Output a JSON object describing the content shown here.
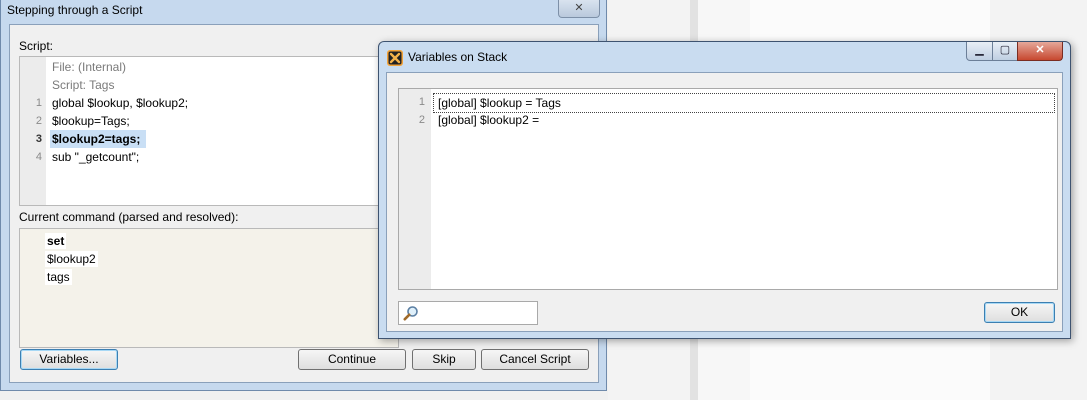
{
  "main_dialog": {
    "title": "Stepping through a Script",
    "close_glyph": "✕",
    "script_label": "Script:",
    "script_lines": [
      {
        "ln": "",
        "text": "File: (Internal)"
      },
      {
        "ln": "",
        "text": "Script: Tags"
      },
      {
        "ln": "1",
        "text": "global $lookup, $lookup2;"
      },
      {
        "ln": "2",
        "text": "$lookup=Tags;"
      },
      {
        "ln": "3",
        "text": "$lookup2=tags;"
      },
      {
        "ln": "4",
        "text": "sub \"_getcount\";"
      }
    ],
    "current_label": "Current command (parsed and resolved):",
    "command_items": [
      "set",
      "$lookup2",
      "tags"
    ],
    "buttons": {
      "variables": "Variables...",
      "continue": "Continue",
      "skip": "Skip",
      "cancel": "Cancel Script"
    }
  },
  "variables_window": {
    "title": "Variables on Stack",
    "caption": {
      "minimize": "▁",
      "maximize": "▢",
      "close": "✕"
    },
    "rows": [
      {
        "ln": "1",
        "text": "[global] $lookup = Tags"
      },
      {
        "ln": "2",
        "text": "[global] $lookup2 = "
      }
    ],
    "search_value": "",
    "ok_label": "OK",
    "icon": "app-x-icon"
  }
}
